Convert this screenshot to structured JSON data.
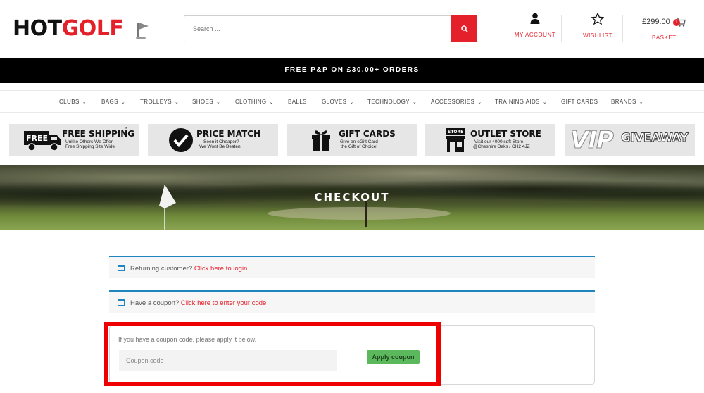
{
  "header": {
    "logo_hot": "HOT",
    "logo_golf": "GOLF",
    "search_placeholder": "Search ...",
    "account_label": "MY ACCOUNT",
    "wishlist_label": "WISHLIST",
    "basket_amount": "£299.00",
    "basket_count": "1",
    "basket_label": "BASKET"
  },
  "promo": {
    "text": "FREE P&P ON £30.00+ ORDERS"
  },
  "nav": {
    "items": [
      {
        "label": "CLUBS",
        "chevron": true
      },
      {
        "label": "BAGS",
        "chevron": true
      },
      {
        "label": "TROLLEYS",
        "chevron": true
      },
      {
        "label": "SHOES",
        "chevron": true
      },
      {
        "label": "CLOTHING",
        "chevron": true
      },
      {
        "label": "BALLS",
        "chevron": false
      },
      {
        "label": "GLOVES",
        "chevron": true
      },
      {
        "label": "TECHNOLOGY",
        "chevron": true
      },
      {
        "label": "ACCESSORIES",
        "chevron": true
      },
      {
        "label": "TRAINING AIDS",
        "chevron": true
      },
      {
        "label": "GIFT CARDS",
        "chevron": false
      },
      {
        "label": "BRANDS",
        "chevron": true
      }
    ]
  },
  "features": {
    "shipping": {
      "title": "FREE SHIPPING",
      "line1": "Unlike Others We Offer",
      "line2": "Free Shipping Site Wide",
      "icon_text": "FREE"
    },
    "price": {
      "title": "PRICE MATCH",
      "line1": "Seen it Cheaper?",
      "line2": "We Wont Be Beaten!"
    },
    "gift": {
      "title": "GIFT CARDS",
      "line1": "Give an eGift Card",
      "line2": "the Gift of Choice!"
    },
    "outlet": {
      "title": "OUTLET STORE",
      "line1": "Visit our 4000 sqft Store",
      "line2": "@Cheshire Oaks / CH2 4JZ",
      "icon_text": "STORE"
    },
    "vip": {
      "title_a": "VIP",
      "title_b": "GIVEAWAY"
    }
  },
  "hero": {
    "title": "CHECKOUT"
  },
  "notices": {
    "returning_text": "Returning customer?",
    "returning_link": "Click here to login",
    "coupon_text": "Have a coupon?",
    "coupon_link": "Click here to enter your code"
  },
  "coupon_form": {
    "hint": "If you have a coupon code, please apply it below.",
    "placeholder": "Coupon code",
    "apply_label": "Apply coupon"
  },
  "colors": {
    "brand_red": "#e4202a",
    "notice_blue": "#1e85be",
    "apply_green": "#5cb85c",
    "highlight": "#ee0000"
  }
}
